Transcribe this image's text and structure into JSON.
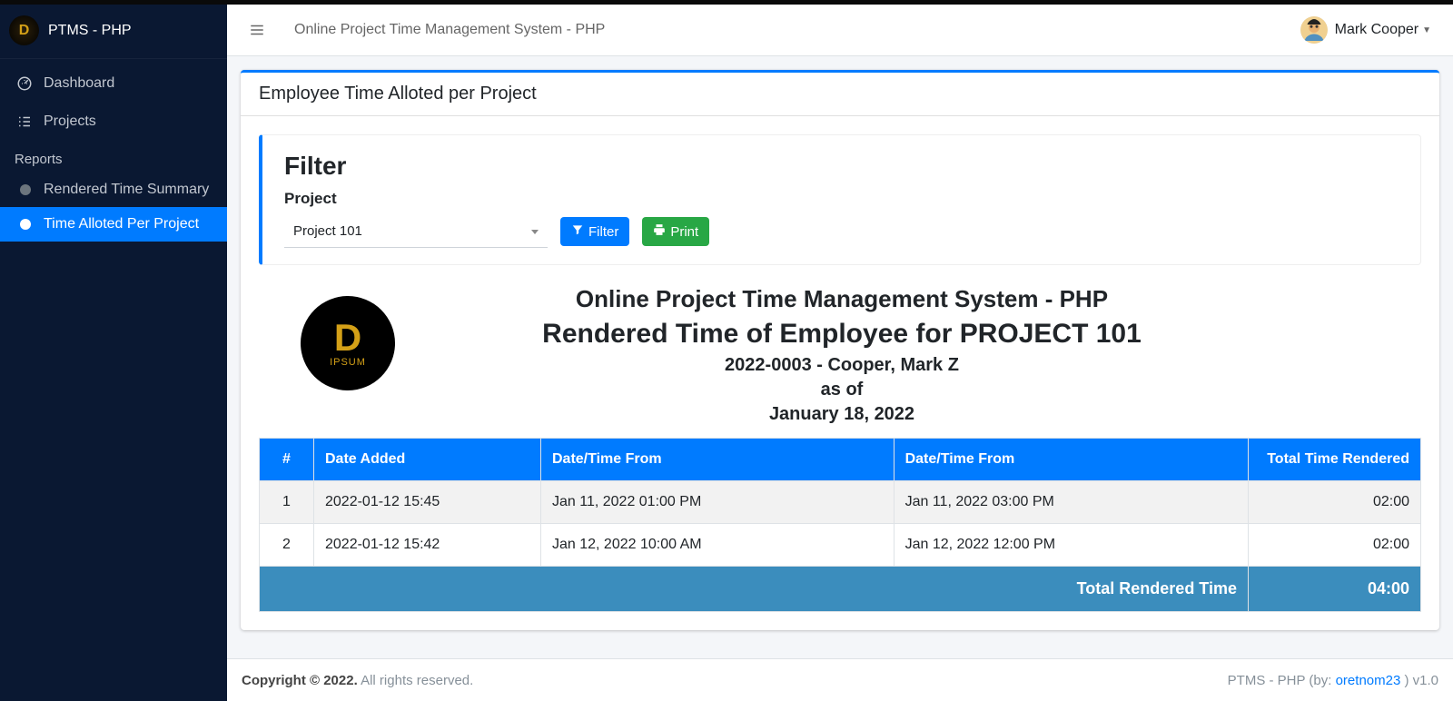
{
  "brand": "PTMS - PHP",
  "topbar_title": "Online Project Time Management System - PHP",
  "user_name": "Mark Cooper",
  "sidebar": {
    "items": [
      {
        "label": "Dashboard"
      },
      {
        "label": "Projects"
      }
    ],
    "section_header": "Reports",
    "reports": [
      {
        "label": "Rendered Time Summary"
      },
      {
        "label": "Time Alloted Per Project"
      }
    ]
  },
  "card_title": "Employee Time Alloted per Project",
  "filter": {
    "heading": "Filter",
    "project_label": "Project",
    "project_selected": "Project 101",
    "filter_btn": "Filter",
    "print_btn": "Print"
  },
  "report": {
    "system_name": "Online Project Time Management System - PHP",
    "title": "Rendered Time of Employee for PROJECT 101",
    "employee": "2022-0003 - Cooper, Mark Z",
    "asof_label": "as of",
    "asof_date": "January 18, 2022",
    "logo_text": "IPSUM"
  },
  "table": {
    "headers": [
      "#",
      "Date Added",
      "Date/Time From",
      "Date/Time From",
      "Total Time Rendered"
    ],
    "rows": [
      {
        "n": "1",
        "date_added": "2022-01-12 15:45",
        "from": "Jan 11, 2022 01:00 PM",
        "to": "Jan 11, 2022 03:00 PM",
        "total": "02:00"
      },
      {
        "n": "2",
        "date_added": "2022-01-12 15:42",
        "from": "Jan 12, 2022 10:00 AM",
        "to": "Jan 12, 2022 12:00 PM",
        "total": "02:00"
      }
    ],
    "footer_label": "Total Rendered Time",
    "footer_value": "04:00"
  },
  "footer": {
    "copyright_strong": "Copyright © 2022.",
    "copyright_rest": " All rights reserved.",
    "right_prefix": "PTMS - PHP (by: ",
    "right_link": "oretnom23",
    "right_suffix": " ) v1.0"
  }
}
